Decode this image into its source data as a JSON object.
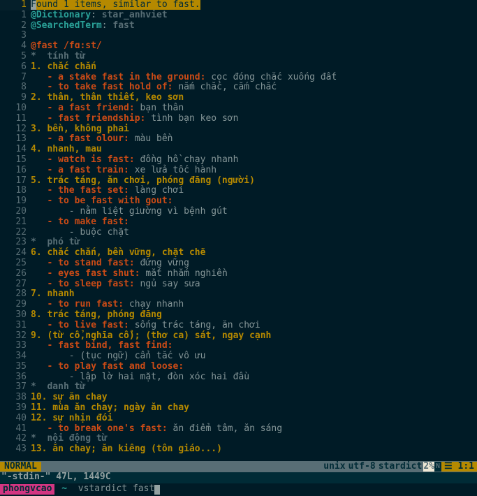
{
  "header": {
    "curlinenum": "1",
    "f_char": "F",
    "found_rest": "ound 1 items, similar to fast."
  },
  "lines": [
    {
      "n": "1",
      "tokens": [
        {
          "c": "cyan",
          "t": "@Dictionary"
        },
        {
          "c": "plain",
          "t": ": "
        },
        {
          "c": "grey",
          "t": "star_anhviet"
        }
      ]
    },
    {
      "n": "2",
      "tokens": [
        {
          "c": "cyan",
          "t": "@SearchedTerm"
        },
        {
          "c": "plain",
          "t": ": "
        },
        {
          "c": "grey",
          "t": "fast"
        }
      ]
    },
    {
      "n": "3",
      "tokens": []
    },
    {
      "n": "4",
      "tokens": [
        {
          "c": "orange-b",
          "t": "@fast /fɑ:st/"
        }
      ]
    },
    {
      "n": "5",
      "tokens": [
        {
          "c": "grey",
          "t": "*  tính từ"
        }
      ]
    },
    {
      "n": "6",
      "tokens": [
        {
          "c": "yellow",
          "t": "1. chắc chắn"
        }
      ]
    },
    {
      "n": "7",
      "tokens": [
        {
          "c": "orange-b",
          "t": "   - a stake fast in the ground:"
        },
        {
          "c": "plain",
          "t": " cọc đóng chắc xuống đất"
        }
      ]
    },
    {
      "n": "8",
      "tokens": [
        {
          "c": "orange-b",
          "t": "   - to take fast hold of:"
        },
        {
          "c": "plain",
          "t": " nắm chắc, cắm chắc"
        }
      ]
    },
    {
      "n": "9",
      "tokens": [
        {
          "c": "yellow",
          "t": "2. thân, thân thiết, keo sơn"
        }
      ]
    },
    {
      "n": "10",
      "tokens": [
        {
          "c": "orange-b",
          "t": "   - a fast friend:"
        },
        {
          "c": "plain",
          "t": " bạn thân"
        }
      ]
    },
    {
      "n": "11",
      "tokens": [
        {
          "c": "orange-b",
          "t": "   - fast friendship:"
        },
        {
          "c": "plain",
          "t": " tình bạn keo sơn"
        }
      ]
    },
    {
      "n": "12",
      "tokens": [
        {
          "c": "yellow",
          "t": "3. bền, không phai"
        }
      ]
    },
    {
      "n": "13",
      "tokens": [
        {
          "c": "orange-b",
          "t": "   - a fast olour:"
        },
        {
          "c": "plain",
          "t": " màu bền"
        }
      ]
    },
    {
      "n": "14",
      "tokens": [
        {
          "c": "yellow",
          "t": "4. nhanh, mau"
        }
      ]
    },
    {
      "n": "15",
      "tokens": [
        {
          "c": "orange-b",
          "t": "   - watch is fast:"
        },
        {
          "c": "plain",
          "t": " đồng hồ chạy nhanh"
        }
      ]
    },
    {
      "n": "16",
      "tokens": [
        {
          "c": "orange-b",
          "t": "   - a fast train:"
        },
        {
          "c": "plain",
          "t": " xe lửa tốc hành"
        }
      ]
    },
    {
      "n": "17",
      "tokens": [
        {
          "c": "yellow",
          "t": "5. trác táng, ăn chơi, phóng đãng (người)"
        }
      ]
    },
    {
      "n": "18",
      "tokens": [
        {
          "c": "orange-b",
          "t": "   - the fast set:"
        },
        {
          "c": "plain",
          "t": " làng chơi"
        }
      ]
    },
    {
      "n": "19",
      "tokens": [
        {
          "c": "orange-b",
          "t": "   - to be fast with gout:"
        }
      ]
    },
    {
      "n": "20",
      "tokens": [
        {
          "c": "plain",
          "t": "       - nằm liệt giường vì bệnh gút"
        }
      ]
    },
    {
      "n": "21",
      "tokens": [
        {
          "c": "orange-b",
          "t": "   - to make fast:"
        }
      ]
    },
    {
      "n": "22",
      "tokens": [
        {
          "c": "plain",
          "t": "       - buộc chặt"
        }
      ]
    },
    {
      "n": "23",
      "tokens": [
        {
          "c": "grey",
          "t": "*  phó từ"
        }
      ]
    },
    {
      "n": "24",
      "tokens": [
        {
          "c": "yellow",
          "t": "6. chắc chắn, bền vững, chặt chẽ"
        }
      ]
    },
    {
      "n": "25",
      "tokens": [
        {
          "c": "orange-b",
          "t": "   - to stand fast:"
        },
        {
          "c": "plain",
          "t": " đứng vững"
        }
      ]
    },
    {
      "n": "26",
      "tokens": [
        {
          "c": "orange-b",
          "t": "   - eyes fast shut:"
        },
        {
          "c": "plain",
          "t": " mắt nhắm nghiền"
        }
      ]
    },
    {
      "n": "27",
      "tokens": [
        {
          "c": "orange-b",
          "t": "   - to sleep fast:"
        },
        {
          "c": "plain",
          "t": " ngủ say sưa"
        }
      ]
    },
    {
      "n": "28",
      "tokens": [
        {
          "c": "yellow",
          "t": "7. nhanh"
        }
      ]
    },
    {
      "n": "29",
      "tokens": [
        {
          "c": "orange-b",
          "t": "   - to run fast:"
        },
        {
          "c": "plain",
          "t": " chạy nhanh"
        }
      ]
    },
    {
      "n": "30",
      "tokens": [
        {
          "c": "yellow",
          "t": "8. trác táng, phóng đãng"
        }
      ]
    },
    {
      "n": "31",
      "tokens": [
        {
          "c": "orange-b",
          "t": "   - to live fast:"
        },
        {
          "c": "plain",
          "t": " sống trác táng, ăn chơi"
        }
      ]
    },
    {
      "n": "32",
      "tokens": [
        {
          "c": "yellow",
          "t": "9. (từ cổ,nghĩa cổ); (thơ ca) sát, ngay cạnh"
        }
      ]
    },
    {
      "n": "33",
      "tokens": [
        {
          "c": "orange-b",
          "t": "   - fast bind, fast find:"
        }
      ]
    },
    {
      "n": "34",
      "tokens": [
        {
          "c": "plain",
          "t": "       - (tục ngữ) cẩn tắc vô ưu"
        }
      ]
    },
    {
      "n": "35",
      "tokens": [
        {
          "c": "orange-b",
          "t": "   - to play fast and loose:"
        }
      ]
    },
    {
      "n": "36",
      "tokens": [
        {
          "c": "plain",
          "t": "       - lập lờ hai mặt, đòn xóc hai đầu"
        }
      ]
    },
    {
      "n": "37",
      "tokens": [
        {
          "c": "grey",
          "t": "*  danh từ"
        }
      ]
    },
    {
      "n": "38",
      "tokens": [
        {
          "c": "yellow",
          "t": "10. sự ăn chay"
        }
      ]
    },
    {
      "n": "39",
      "tokens": [
        {
          "c": "yellow",
          "t": "11. mùa ăn chay; ngày ăn chay"
        }
      ]
    },
    {
      "n": "40",
      "tokens": [
        {
          "c": "yellow",
          "t": "12. sự nhịn đói"
        }
      ]
    },
    {
      "n": "41",
      "tokens": [
        {
          "c": "orange-b",
          "t": "   - to break one's fast:"
        },
        {
          "c": "plain",
          "t": " ăn điểm tâm, ăn sáng"
        }
      ]
    },
    {
      "n": "42",
      "tokens": [
        {
          "c": "grey",
          "t": "*  nội động từ"
        }
      ]
    },
    {
      "n": "43",
      "tokens": [
        {
          "c": "yellow",
          "t": "13. ăn chay; ăn kiêng (tôn giáo...)"
        }
      ]
    }
  ],
  "status": {
    "mode": " NORMAL ",
    "unix": "unix",
    "enc": "utf-8",
    "ft": "stardict",
    "pct": "2%",
    "sym": "☰ ",
    "pos": "1:1"
  },
  "msg": "\"-stdin-\" 47L, 1449C",
  "prompt": {
    "user": "phongvcao",
    "path": " ~ ",
    "arrow": "",
    "cmd": "vstardict fast"
  }
}
